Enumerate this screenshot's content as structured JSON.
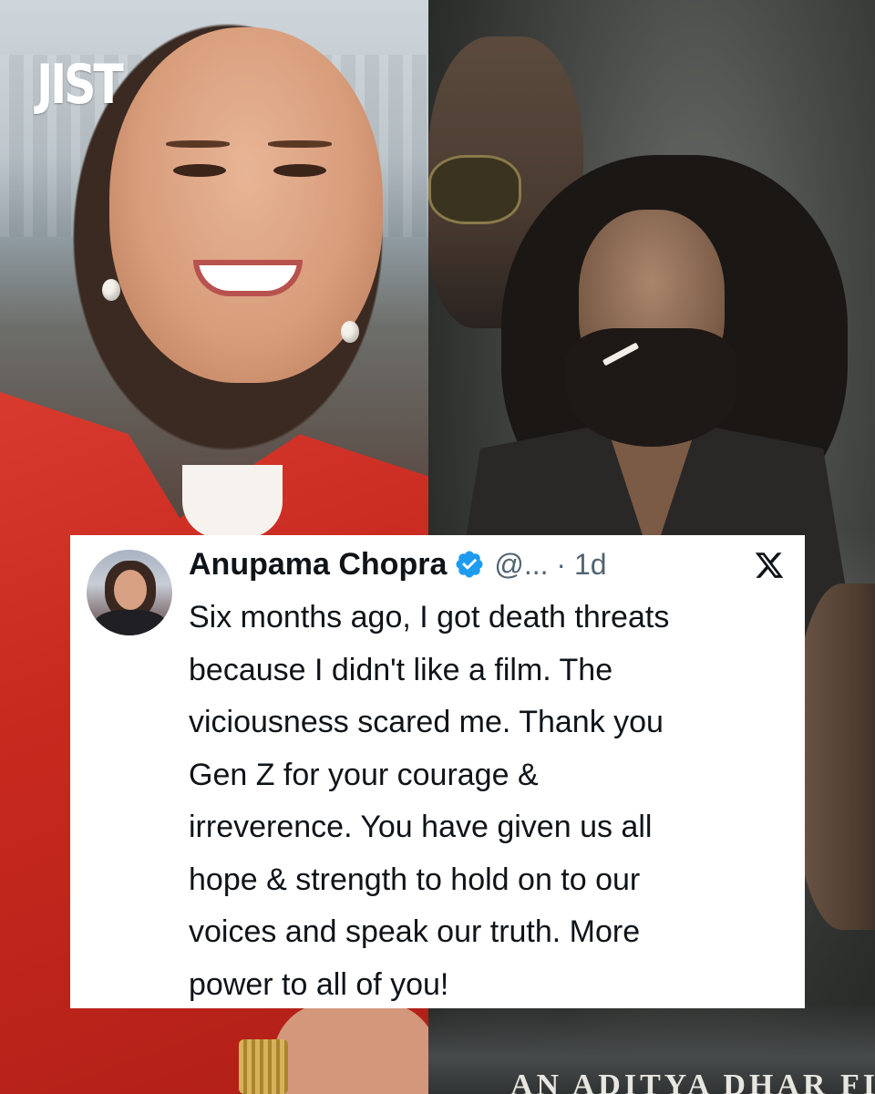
{
  "brand": {
    "logo_text": "JIST"
  },
  "tweet": {
    "name": "Anupama Chopra",
    "handle_time": "@... · 1d",
    "text": "Six months ago, I got death threats\nbecause I didn't like a film. The\nviciousness scared me. Thank you\nGen Z for your courage &\nirreverence. You have given us all\nhope & strength to hold on to our\nvoices and speak our truth.  More\npower to all of you!",
    "icons": {
      "verified": "verified-badge-icon",
      "platform": "x-logo-icon"
    },
    "colors": {
      "verified": "#1d9bf0",
      "text": "#0f1419",
      "secondary": "#536471"
    }
  },
  "poster": {
    "credit_text": "AN ADITYA DHAR FILM"
  }
}
